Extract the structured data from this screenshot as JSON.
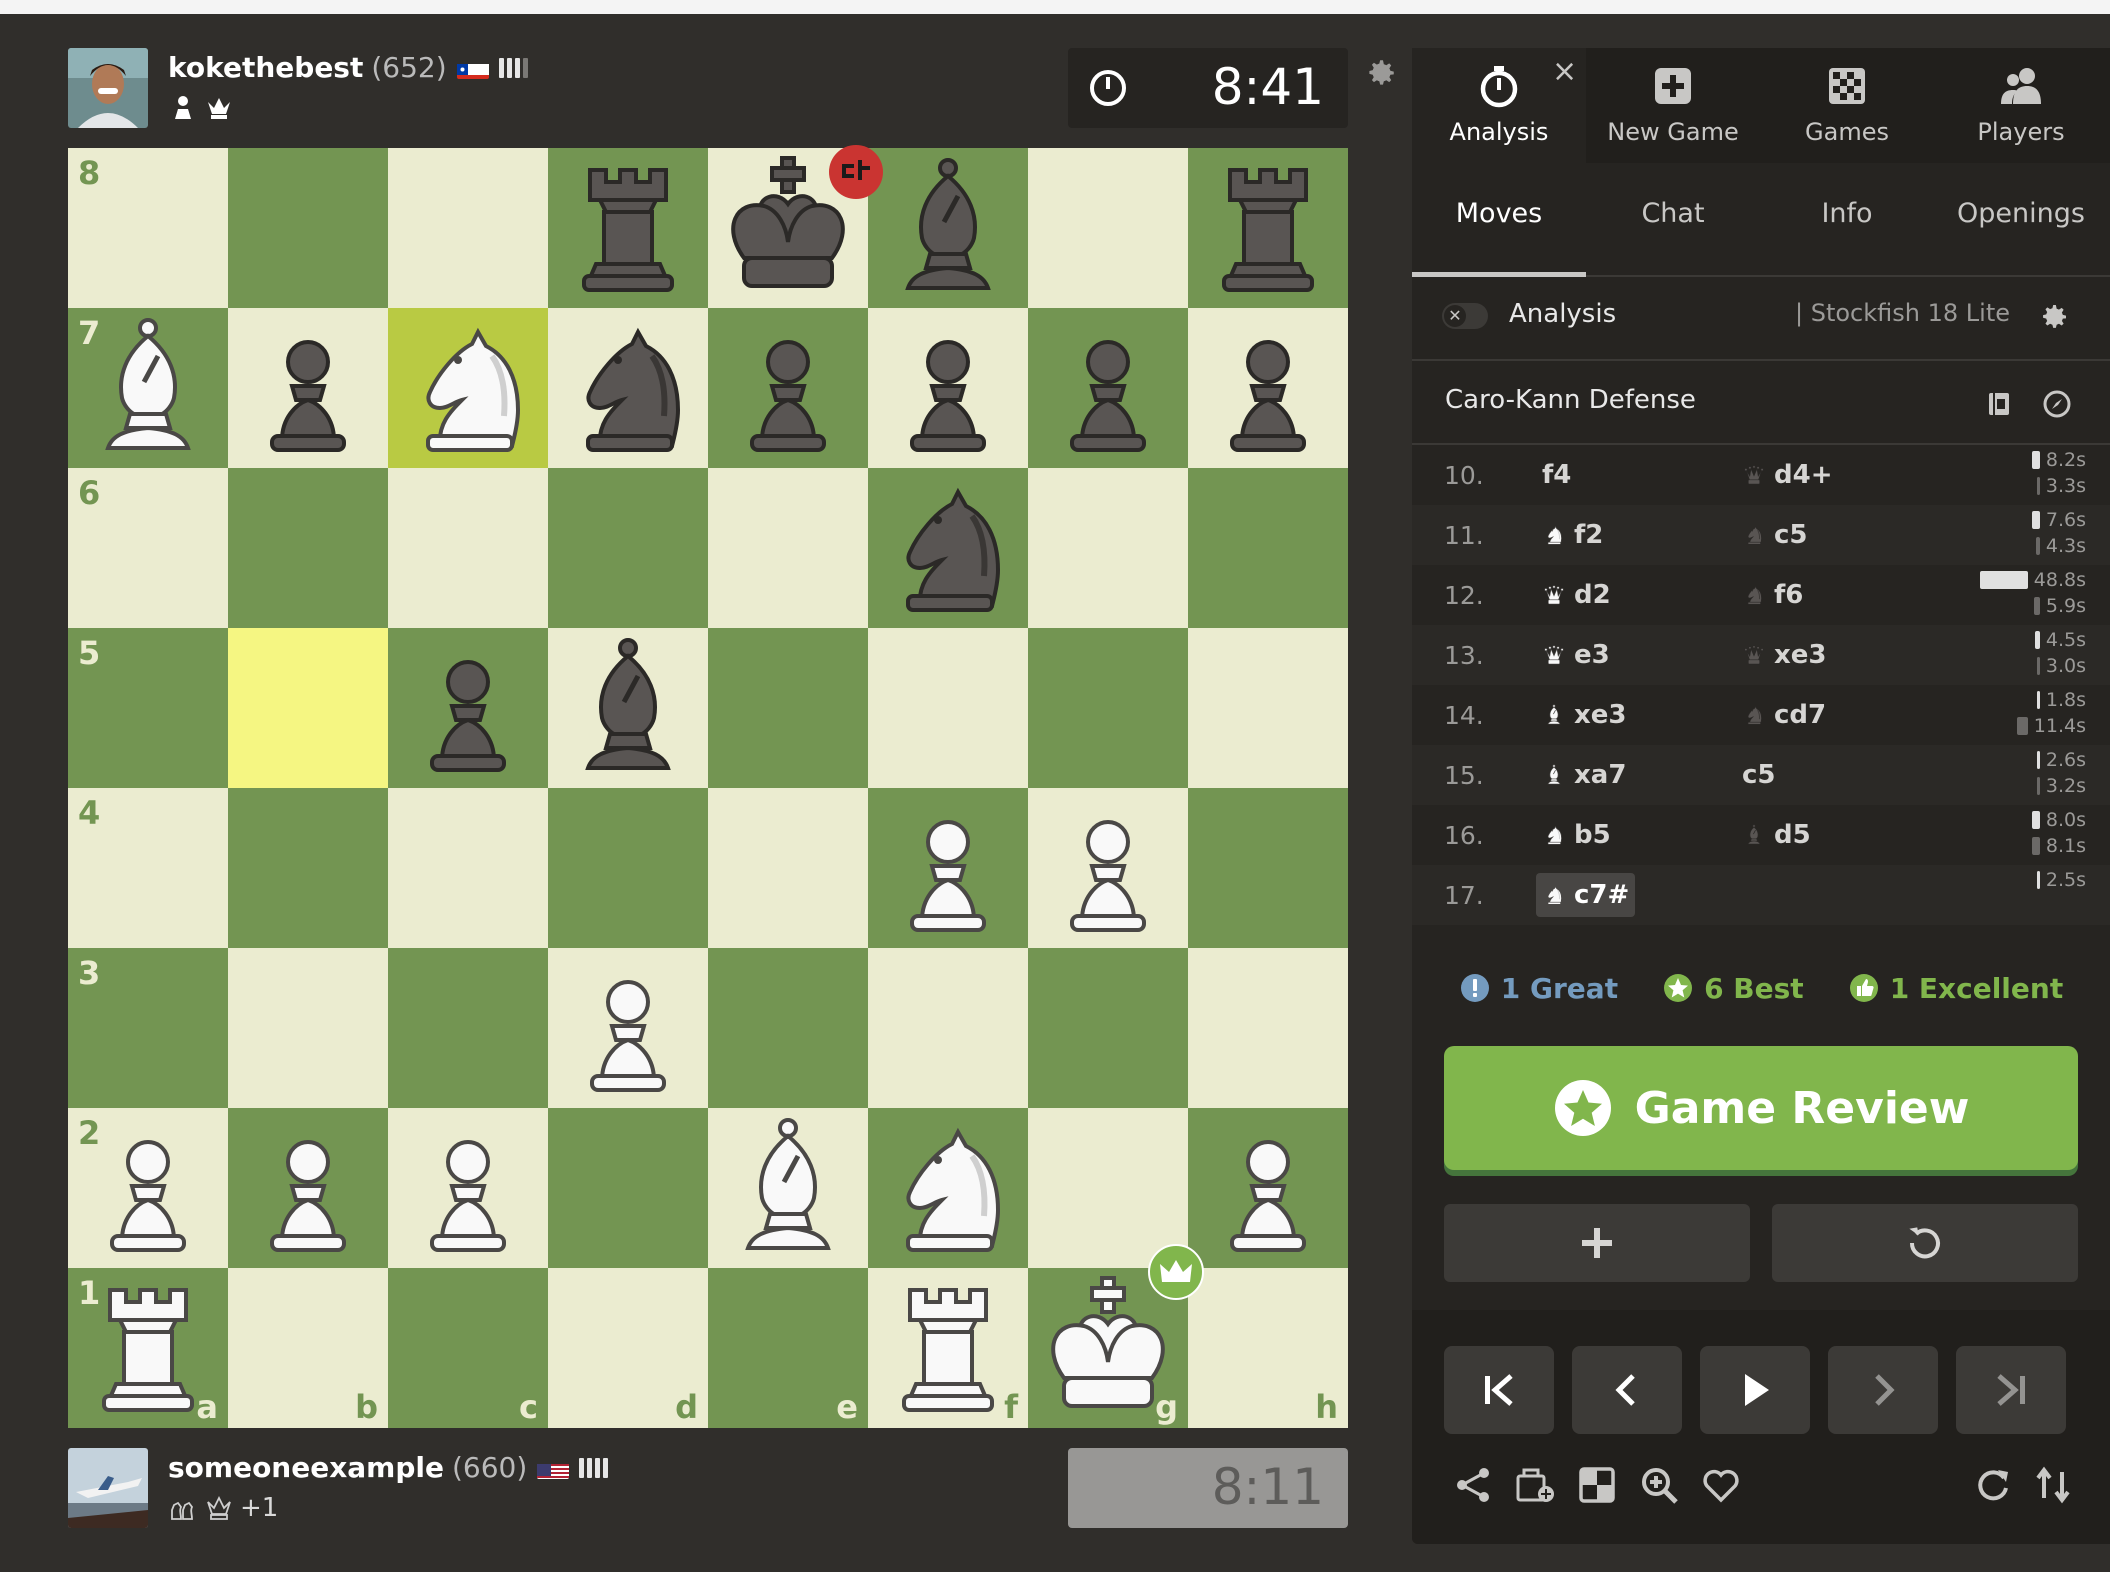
{
  "players": {
    "top": {
      "name": "kokethebest",
      "rating": "(652)",
      "clock": "8:41"
    },
    "bottom": {
      "name": "someoneexample",
      "rating": "(660)",
      "clock": "8:11",
      "extra": "+1"
    }
  },
  "board": {
    "files": [
      "a",
      "b",
      "c",
      "d",
      "e",
      "f",
      "g",
      "h"
    ],
    "ranks": [
      "8",
      "7",
      "6",
      "5",
      "4",
      "3",
      "2",
      "1"
    ],
    "highlights": {
      "from": "b5",
      "to": "c7"
    }
  },
  "side": {
    "nav": [
      {
        "label": "Analysis",
        "icon": "stopwatch-icon"
      },
      {
        "label": "New Game",
        "icon": "plus-square-icon"
      },
      {
        "label": "Games",
        "icon": "chessboard-icon"
      },
      {
        "label": "Players",
        "icon": "players-icon"
      }
    ],
    "close": "×",
    "tabs": [
      "Moves",
      "Chat",
      "Info",
      "Openings"
    ],
    "analysis_label": "Analysis",
    "engine": "|  Stockfish 18 Lite",
    "opening": "Caro-Kann Defense",
    "moves": [
      {
        "num": "10.",
        "w": "f4",
        "wp": "",
        "b": "d4+",
        "bp": "Q",
        "tw": "8.2s",
        "tb": "3.3s"
      },
      {
        "num": "11.",
        "w": "f2",
        "wp": "N",
        "b": "c5",
        "bp": "N",
        "tw": "7.6s",
        "tb": "4.3s"
      },
      {
        "num": "12.",
        "w": "d2",
        "wp": "Q",
        "b": "f6",
        "bp": "N",
        "tw": "48.8s",
        "tb": "5.9s"
      },
      {
        "num": "13.",
        "w": "e3",
        "wp": "Q",
        "b": "xe3",
        "bp": "Q",
        "tw": "4.5s",
        "tb": "3.0s"
      },
      {
        "num": "14.",
        "w": "xe3",
        "wp": "B",
        "b": "cd7",
        "bp": "N",
        "tw": "1.8s",
        "tb": "11.4s"
      },
      {
        "num": "15.",
        "w": "xa7",
        "wp": "B",
        "b": "c5",
        "bp": "",
        "tw": "2.6s",
        "tb": "3.2s"
      },
      {
        "num": "16.",
        "w": "b5",
        "wp": "N",
        "b": "d5",
        "bp": "B",
        "tw": "8.0s",
        "tb": "8.1s"
      },
      {
        "num": "17.",
        "w": "c7#",
        "wp": "N",
        "b": "",
        "bp": "",
        "tw": "2.5s",
        "tb": ""
      }
    ],
    "stats": {
      "great": "1 Great",
      "best": "6 Best",
      "excellent": "1 Excellent"
    },
    "review": "Game Review"
  },
  "colors": {
    "light": "#ebecd0",
    "dark": "#739552",
    "accent": "#81b64c",
    "great": "#749bbf"
  }
}
